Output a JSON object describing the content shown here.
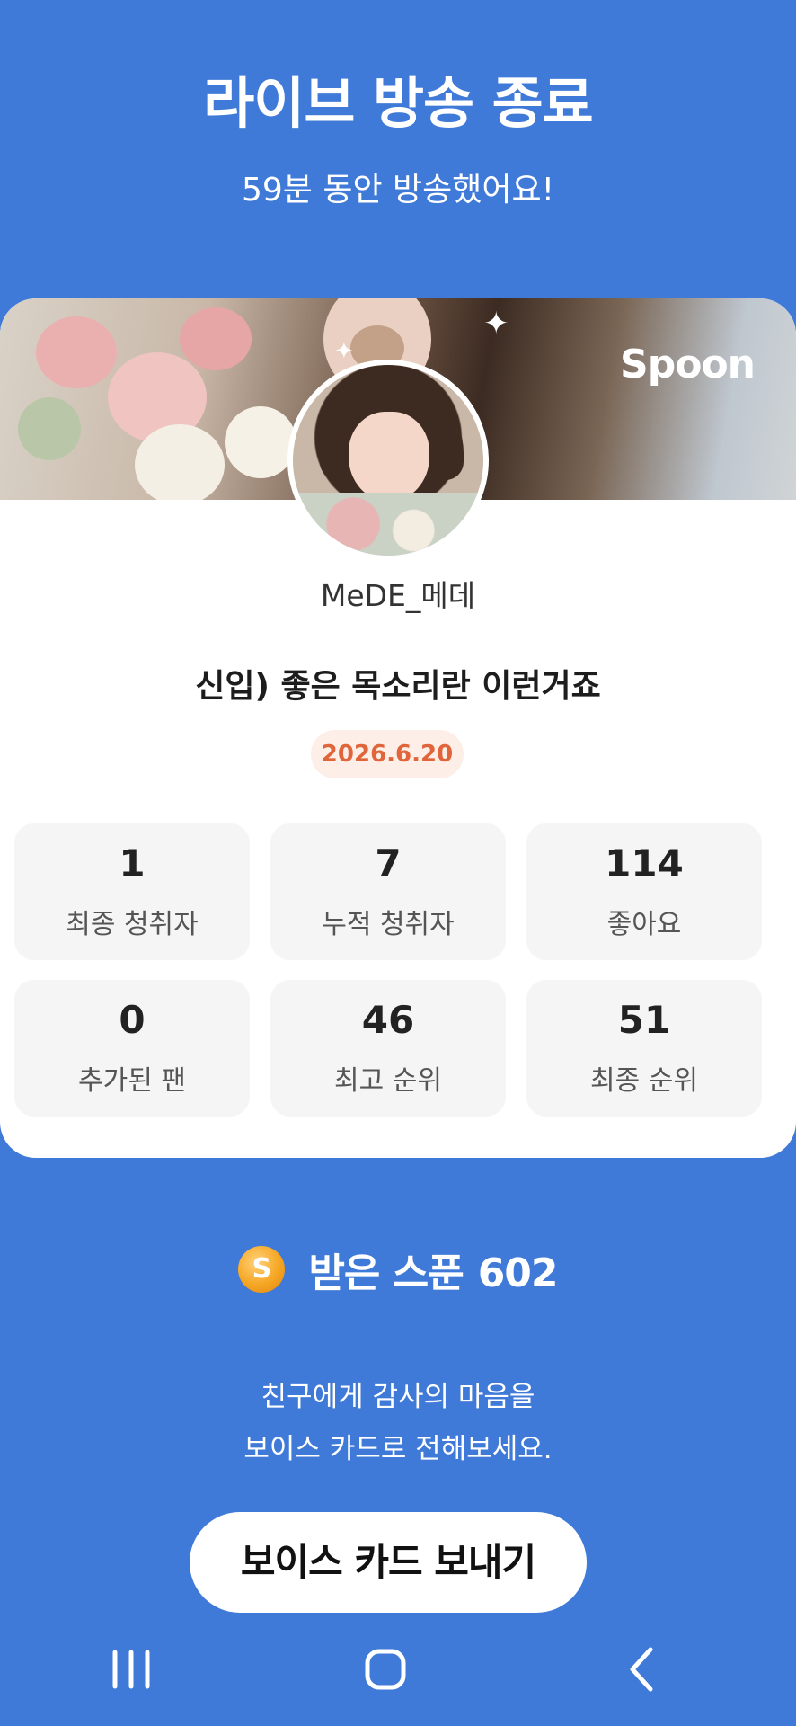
{
  "header": {
    "title": "라이브 방송 종료",
    "subtitle": "59분 동안 방송했어요!"
  },
  "banner": {
    "brand": "Spoon"
  },
  "profile": {
    "username": "MeDE_메데"
  },
  "broadcast": {
    "title": "신입) 좋은 목소리란 이런거죠",
    "date": "2026.6.20"
  },
  "stats": [
    {
      "value": "1",
      "label": "최종 청취자"
    },
    {
      "value": "7",
      "label": "누적 청취자"
    },
    {
      "value": "114",
      "label": "좋아요"
    },
    {
      "value": "0",
      "label": "추가된 팬"
    },
    {
      "value": "46",
      "label": "최고 순위"
    },
    {
      "value": "51",
      "label": "최종 순위"
    }
  ],
  "spoons": {
    "coin_letter": "S",
    "label": "받은 스푼",
    "amount": "602"
  },
  "message": {
    "line1": "친구에게 감사의 마음을",
    "line2": "보이스 카드로 전해보세요."
  },
  "cta": {
    "label": "보이스 카드 보내기"
  },
  "colors": {
    "background": "#3f7ad8",
    "date_badge_text": "#e0653a",
    "date_badge_bg": "#fdeee7",
    "stat_tile_bg": "#f5f5f5"
  },
  "icons": {
    "coin": "spoon-coin-icon",
    "nav_recent": "recent-apps-icon",
    "nav_home": "home-icon",
    "nav_back": "back-icon"
  }
}
